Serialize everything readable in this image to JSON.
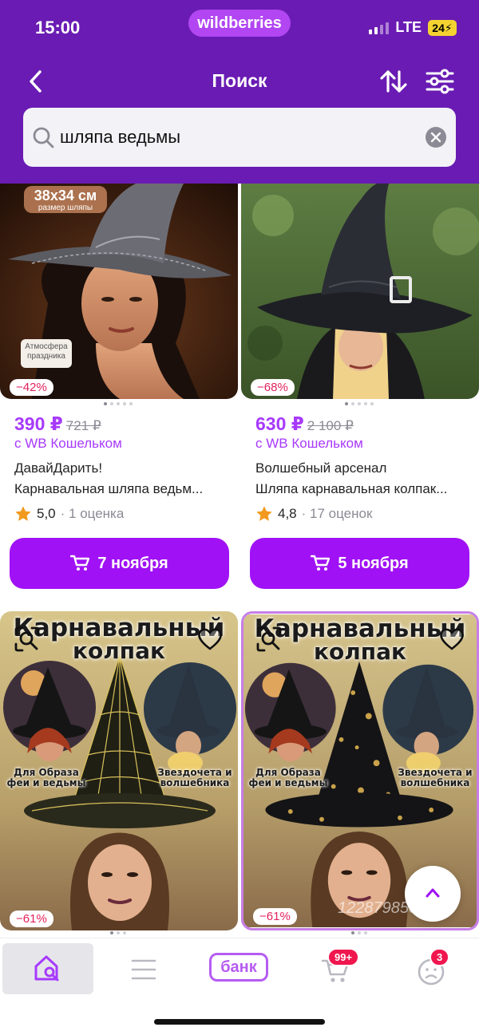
{
  "status_bar": {
    "time": "15:00",
    "network": "LTE",
    "battery": "24"
  },
  "app_logo": "wildberries",
  "header": {
    "title": "Поиск"
  },
  "search": {
    "value": "шляпа ведьмы"
  },
  "colors": {
    "header_bg": "#6a1bb3",
    "accent": "#a73afd",
    "button": "#a012f5",
    "discount": "#e2225c",
    "badge": "#f0174f"
  },
  "products": [
    {
      "image_labels": {
        "size": "38x34 см",
        "size_sub": "размер шляпы",
        "tag": "Атмосфера праздника"
      },
      "discount": "−42%",
      "price": "390 ₽",
      "old_price": "721 ₽",
      "wallet": "с WB Кошельком",
      "brand": "ДавайДарить!",
      "name": "Карнавальная шляпа ведьм...",
      "rating": "5,0",
      "reviews": "· 1 оценка",
      "delivery": "7 ноября"
    },
    {
      "discount": "−68%",
      "price": "630 ₽",
      "old_price": "2 100 ₽",
      "wallet": "с WB Кошельком",
      "brand": "Волшебный арсенал",
      "name": "Шляпа карнавальная колпак...",
      "rating": "4,8",
      "reviews": "· 17 оценок",
      "delivery": "5 ноября"
    },
    {
      "image_labels": {
        "title1": "Карнавальный",
        "title2": "колпак",
        "left": "Для Образа\nфеи и ведьмы",
        "right": "Звездочета и\nволшебника"
      },
      "discount": "−61%"
    },
    {
      "image_labels": {
        "title1": "Карнавальный",
        "title2": "колпак",
        "left": "Для Образа\nфеи и ведьмы",
        "right": "Звездочета и\nволшебника",
        "watermark": "122879855"
      },
      "discount": "−61%"
    }
  ],
  "tabbar": {
    "bank": "банк",
    "cart_badge": "99+",
    "profile_badge": "3"
  }
}
